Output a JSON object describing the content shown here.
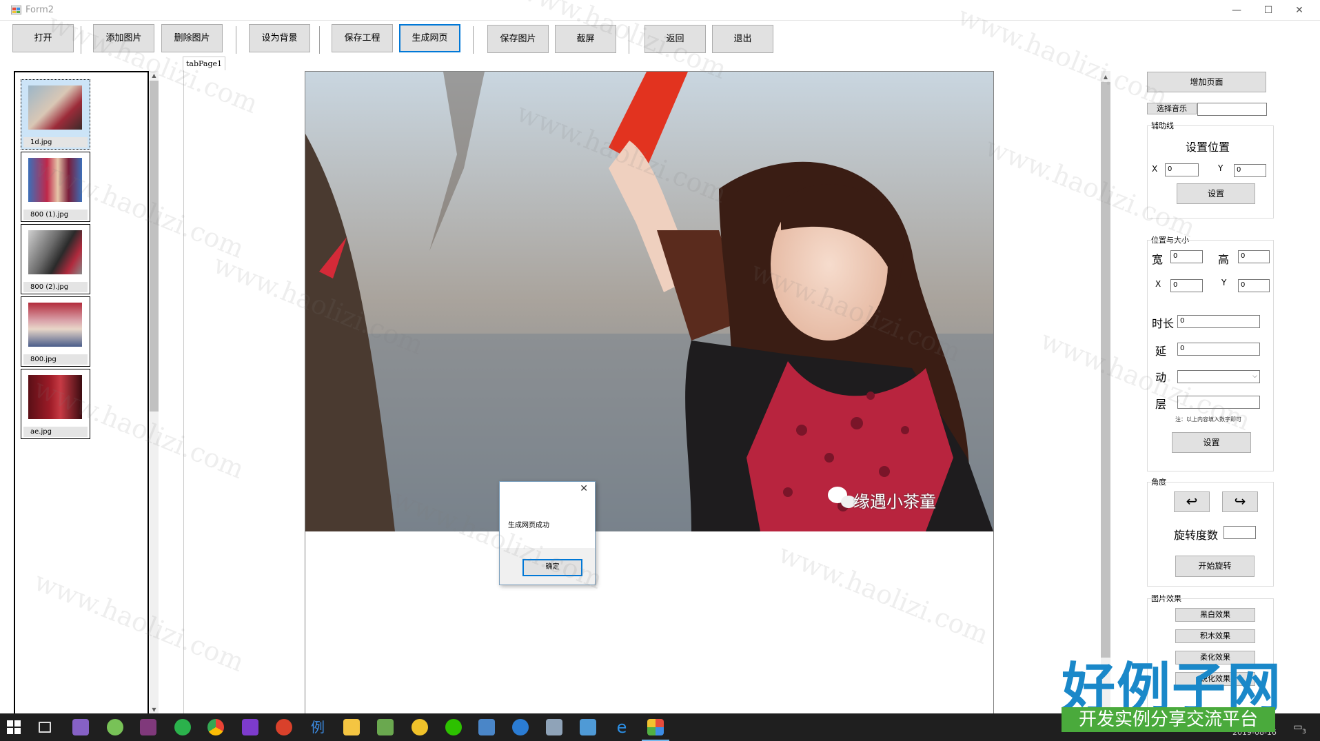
{
  "window": {
    "title": "Form2"
  },
  "toolbar": {
    "open": "打开",
    "add_image": "添加图片",
    "delete_image": "删除图片",
    "set_background": "设为背景",
    "save_project": "保存工程",
    "generate_webpage": "生成网页",
    "save_image": "保存图片",
    "screenshot": "截屏",
    "back": "返回",
    "exit": "退出"
  },
  "thumbnails": [
    {
      "caption": "1d.jpg",
      "selected": true
    },
    {
      "caption": "800 (1).jpg"
    },
    {
      "caption": "800 (2).jpg"
    },
    {
      "caption": "800.jpg"
    },
    {
      "caption": "ae.jpg"
    }
  ],
  "tab": {
    "label": "tabPage1"
  },
  "canvas": {
    "image_text": "缘遇小茶童"
  },
  "dialog": {
    "message": "生成网页成功",
    "ok": "确定",
    "close": "✕"
  },
  "right_panel": {
    "add_page": "增加页面",
    "select_music": "选择音乐",
    "music_value": "",
    "guide_line": "辅助线",
    "set_position_title": "设置位置",
    "x_label": "X",
    "y_label": "Y",
    "guide_x": "0",
    "guide_y": "0",
    "set_button": "设置",
    "pos_size_title": "位置与大小",
    "width_label": "宽",
    "height_label": "高",
    "width": "0",
    "height": "0",
    "pos_x_label": "X",
    "pos_y_label": "Y",
    "pos_x": "0",
    "pos_y": "0",
    "duration_label": "时长",
    "duration": "0",
    "delay_label": "延",
    "delay": "0",
    "motion_label": "动",
    "layer_label": "层",
    "note": "注：以上内容填入数字即可",
    "set_button2": "设置",
    "angle_title": "角度",
    "rotate_degrees_label": "旋转度数",
    "rotate_value": "",
    "start_rotate": "开始旋转",
    "effects_title": "图片效果",
    "effect_bw": "黑白效果",
    "effect_blocks": "积木效果",
    "effect_3": "柔化效果",
    "effect_4": "锐化效果"
  },
  "watermark_text": "www.haolizi.com",
  "logo": {
    "main": "好例子网",
    "sub": "开发实例分享交流平台"
  },
  "taskbar": {
    "date": "2019-08-16",
    "notify_count": "3"
  },
  "colors": {
    "focus": "#0078d7",
    "taskbar": "#1f1f1f",
    "logo_blue": "#1a88c9",
    "logo_green": "#4aaa3c"
  }
}
